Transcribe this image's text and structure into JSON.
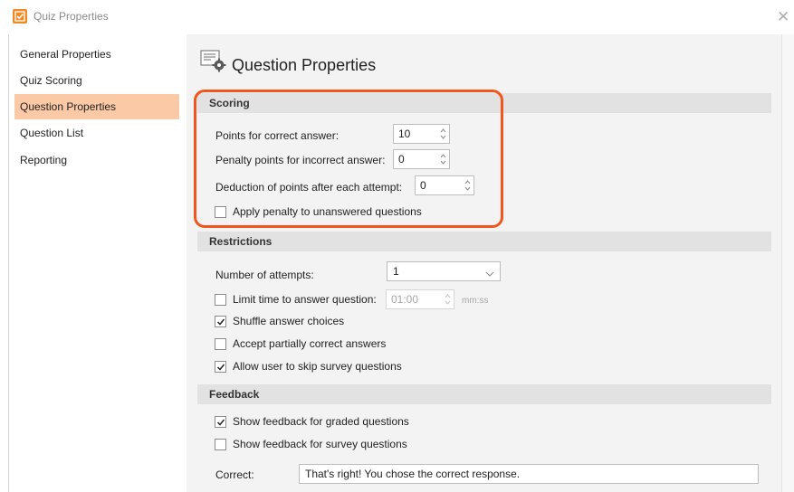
{
  "window": {
    "title": "Quiz Properties",
    "close_glyph": "✕",
    "icon": "checkbox-app-icon"
  },
  "sidebar": {
    "items": [
      {
        "label": "General Properties",
        "active": false
      },
      {
        "label": "Quiz Scoring",
        "active": false
      },
      {
        "label": "Question Properties",
        "active": true
      },
      {
        "label": "Question List",
        "active": false
      },
      {
        "label": "Reporting",
        "active": false
      }
    ],
    "active_color": "#fbc9a5"
  },
  "page": {
    "title": "Question Properties",
    "icon": "question-settings-icon"
  },
  "scoring": {
    "heading": "Scoring",
    "points_correct_label": "Points for correct answer:",
    "points_correct_value": "10",
    "penalty_label": "Penalty points for incorrect answer:",
    "penalty_value": "0",
    "deduction_label": "Deduction of points after each attempt:",
    "deduction_value": "0",
    "apply_penalty_label": "Apply penalty to unanswered questions",
    "apply_penalty_checked": false
  },
  "restrictions": {
    "heading": "Restrictions",
    "attempts_label": "Number of attempts:",
    "attempts_value": "1",
    "limit_time_label": "Limit time to answer question:",
    "limit_time_checked": false,
    "limit_time_value": "01:00",
    "limit_time_unit": "mm:ss",
    "shuffle_label": "Shuffle answer choices",
    "shuffle_checked": true,
    "partial_label": "Accept partially correct answers",
    "partial_checked": false,
    "skip_label": "Allow user to skip survey questions",
    "skip_checked": true
  },
  "feedback": {
    "heading": "Feedback",
    "graded_label": "Show feedback for graded questions",
    "graded_checked": true,
    "survey_label": "Show feedback for survey questions",
    "survey_checked": false,
    "correct_label": "Correct:",
    "correct_value": "That's right!  You chose the correct response."
  },
  "colors": {
    "highlight": "#f0561d",
    "app_icon": "#f08a24",
    "section_bg": "#e2e2e2",
    "panel_bg": "#f3f3f3"
  }
}
